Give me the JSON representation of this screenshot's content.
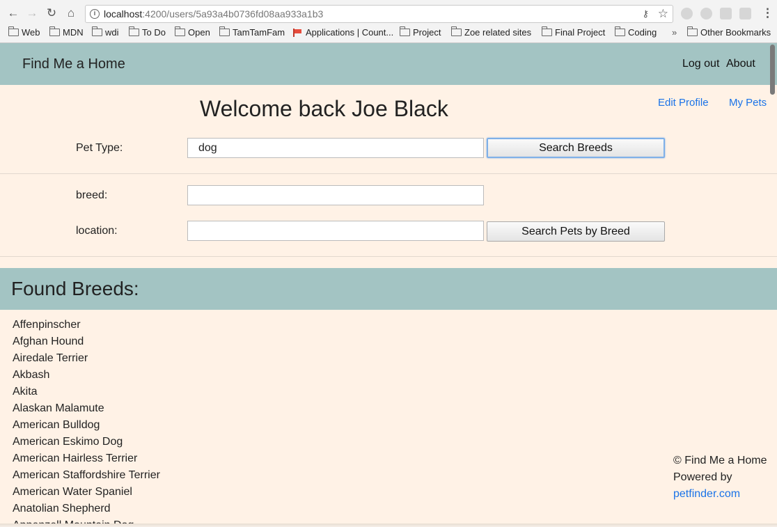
{
  "browser": {
    "url_host": "localhost",
    "url_rest": ":4200/users/5a93a4b0736fd08aa933a1b3",
    "icons": [
      "back-icon",
      "forward-icon",
      "reload-icon",
      "home-icon",
      "info-icon",
      "key-icon",
      "star-icon",
      "menu-icon"
    ],
    "bookmarks": [
      "Web",
      "MDN",
      "wdi",
      "To Do",
      "Open",
      "TamTamFam",
      "Applications | Count...",
      "Project",
      "Zoe related sites",
      "Final Project",
      "Coding"
    ],
    "overflow_label": "»",
    "other_bookmarks": "Other Bookmarks"
  },
  "nav": {
    "brand": "Find Me a Home",
    "logout": "Log out",
    "about": "About"
  },
  "main": {
    "welcome": "Welcome back Joe Black",
    "edit_profile": "Edit Profile",
    "my_pets": "My Pets",
    "pet_type_label": "Pet Type:",
    "pet_type_value": "dog",
    "search_breeds_button": "Search Breeds",
    "breed_label": "breed:",
    "breed_value": "",
    "location_label": "location:",
    "location_value": "",
    "search_pets_button": "Search Pets by Breed"
  },
  "found": {
    "title": "Found Breeds:",
    "breeds": [
      "Affenpinscher",
      "Afghan Hound",
      "Airedale Terrier",
      "Akbash",
      "Akita",
      "Alaskan Malamute",
      "American Bulldog",
      "American Eskimo Dog",
      "American Hairless Terrier",
      "American Staffordshire Terrier",
      "American Water Spaniel",
      "Anatolian Shepherd",
      "Appenzell Mountain Dog"
    ]
  },
  "footer": {
    "copyright": "© Find Me a Home",
    "powered_by": "Powered by",
    "link": "petfinder.com"
  },
  "colors": {
    "accent_bar": "#a3c4c3",
    "page_background": "#fff2e6",
    "link": "#1a73e8"
  }
}
